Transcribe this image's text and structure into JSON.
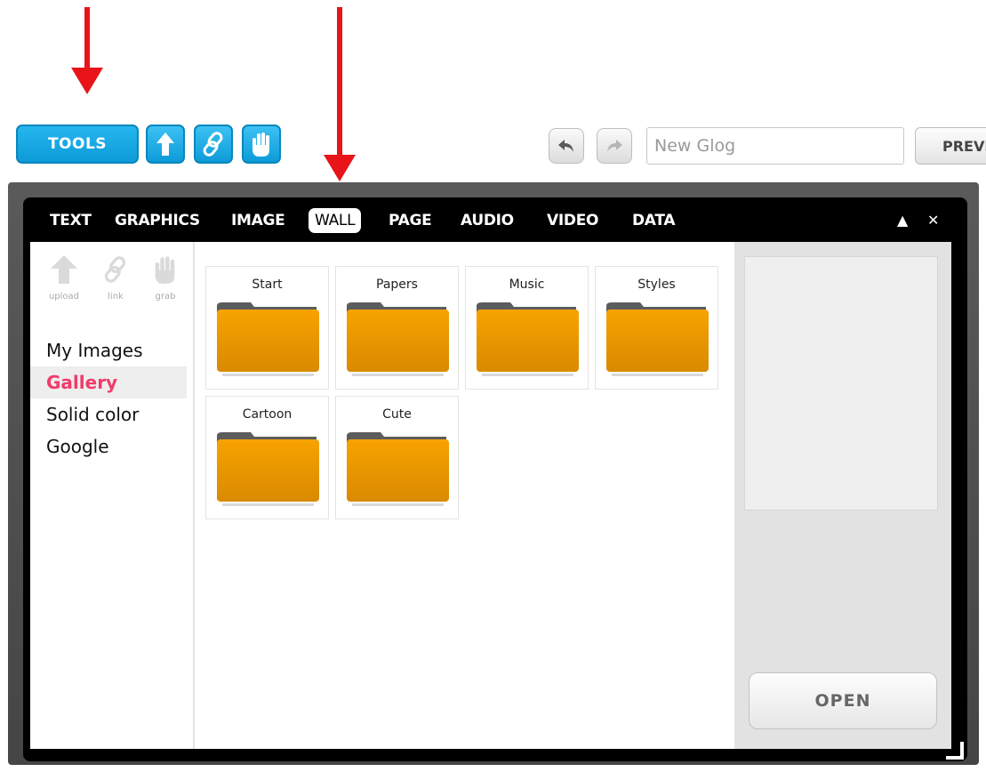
{
  "toolbar": {
    "tools_label": "TOOLS",
    "upload_icon": "upload-arrow-icon",
    "link_icon": "link-icon",
    "grab_icon": "hand-icon",
    "undo_icon": "undo-icon",
    "redo_icon": "redo-icon",
    "title_placeholder": "New Glog",
    "preview_label": "PREVIEW"
  },
  "panel": {
    "tabs": [
      {
        "label": "TEXT"
      },
      {
        "label": "GRAPHICS"
      },
      {
        "label": "IMAGE"
      },
      {
        "label": "WALL",
        "active": true
      },
      {
        "label": "PAGE"
      },
      {
        "label": "AUDIO"
      },
      {
        "label": "VIDEO"
      },
      {
        "label": "DATA"
      }
    ],
    "minimize_glyph": "▲",
    "close_glyph": "✕",
    "sources": [
      {
        "label": "upload",
        "icon": "upload-arrow-icon"
      },
      {
        "label": "link",
        "icon": "link-icon"
      },
      {
        "label": "grab",
        "icon": "hand-icon"
      }
    ],
    "nav": [
      {
        "label": "My Images"
      },
      {
        "label": "Gallery",
        "active": true
      },
      {
        "label": "Solid color"
      },
      {
        "label": "Google"
      }
    ],
    "folders": [
      {
        "name": "Start"
      },
      {
        "name": "Papers"
      },
      {
        "name": "Music"
      },
      {
        "name": "Styles"
      },
      {
        "name": "Cartoon"
      },
      {
        "name": "Cute"
      }
    ],
    "open_label": "OPEN"
  },
  "colors": {
    "accent_blue": "#0d9bd8",
    "active_nav_pink": "#f23b6b",
    "folder_orange": "#f29a00",
    "annotation_red": "#e8141a"
  }
}
